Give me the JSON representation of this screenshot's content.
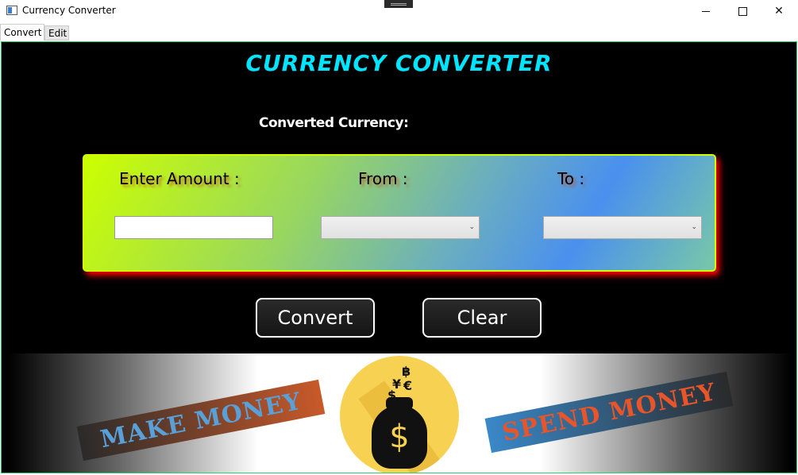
{
  "window": {
    "title": "Currency Converter",
    "controls": {
      "minimize": "minimize-icon",
      "maximize": "maximize-icon",
      "close": "✕"
    }
  },
  "tabs": [
    {
      "label": "Convert",
      "active": true
    },
    {
      "label": "Edit",
      "active": false
    }
  ],
  "main": {
    "title": "CURRENCY CONVERTER",
    "converted_label": "Converted Currency:",
    "form": {
      "amount_label": "Enter Amount :",
      "from_label": "From :",
      "to_label": "To :",
      "amount_value": "",
      "from_value": "",
      "to_value": ""
    },
    "buttons": {
      "convert": "Convert",
      "clear": "Clear"
    }
  },
  "banner": {
    "left_tag": "MAKE MONEY",
    "right_tag": "SPEND MONEY",
    "bag_symbol": "$",
    "symbols": [
      "฿",
      "¥",
      "€",
      "$"
    ]
  },
  "colors": {
    "title": "#00e5ff",
    "panel_border": "#ccff00",
    "panel_glow": "#ff0000",
    "coin": "#f7d152"
  }
}
